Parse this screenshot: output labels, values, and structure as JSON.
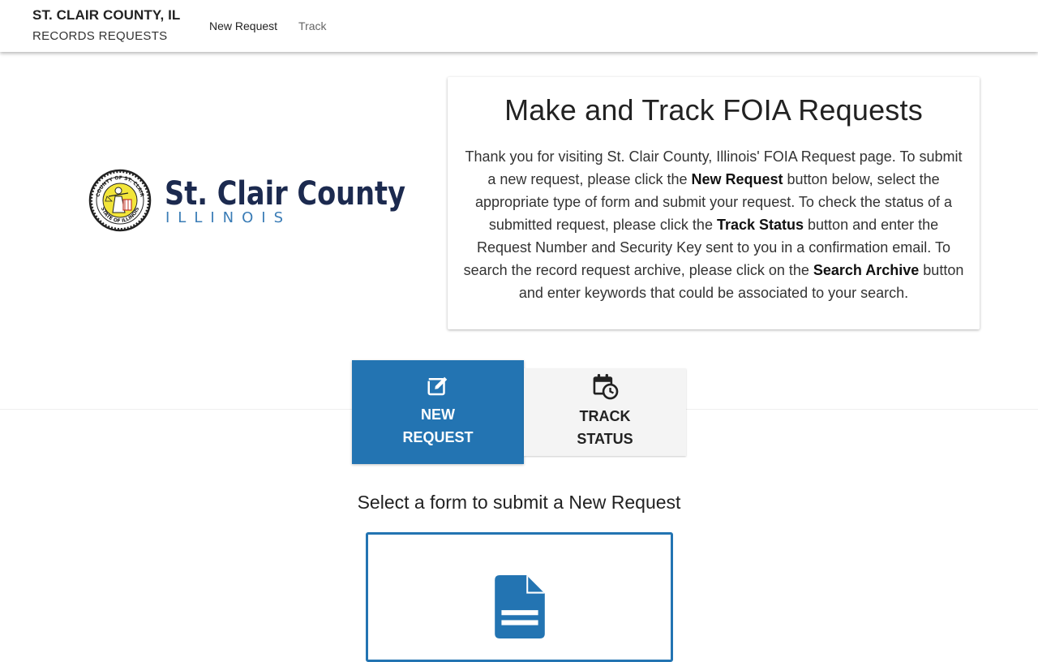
{
  "header": {
    "brand_title": "ST. CLAIR COUNTY, IL",
    "brand_subtitle": "RECORDS REQUESTS",
    "nav": {
      "new_request": "New Request",
      "track": "Track"
    }
  },
  "logo": {
    "name": "St. Clair County",
    "state": "ILLINOIS",
    "seal_top": "COUNTY OF ST. CLAIR",
    "seal_bottom": "STATE OF ILLINOIS"
  },
  "intro": {
    "title": "Make and Track FOIA Requests",
    "p1": "Thank you for visiting St. Clair County, Illinois' FOIA Request page. To submit a new request, please click the ",
    "b1": "New Request",
    "p2": " button below, select the appropriate type of form and submit your request. To check the status of a submitted request, please click the ",
    "b2": "Track Status",
    "p3": " button and enter the Request Number and Security Key sent to you in a confirmation email. To search the record request archive, please click on the ",
    "b3": "Search Archive",
    "p4": " button and enter keywords that could be associated to your search."
  },
  "tabs": {
    "new_line1": "NEW",
    "new_line2": "REQUEST",
    "track_line1": "TRACK",
    "track_line2": "STATUS",
    "new_icon": "edit-icon",
    "track_icon": "calendar-clock-icon"
  },
  "main": {
    "section_title": "Select a form to submit a New Request",
    "form_icon": "document-icon"
  },
  "colors": {
    "accent": "#2374b2",
    "logo_navy": "#1c2a4f",
    "logo_blue": "#3a7cb6",
    "inactive_tab": "#f4f4f4"
  }
}
